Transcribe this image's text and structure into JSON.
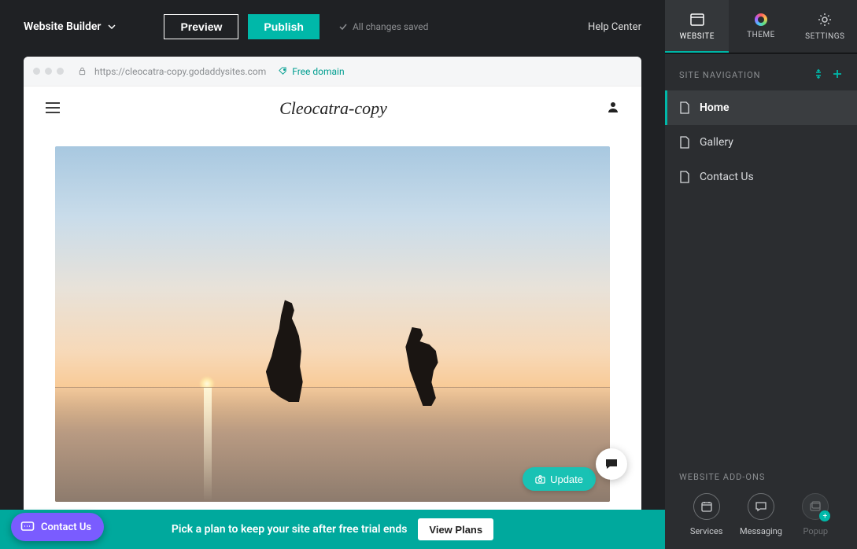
{
  "topbar": {
    "brand": "Website Builder",
    "preview_label": "Preview",
    "publish_label": "Publish",
    "saved_label": "All changes saved",
    "help_label": "Help Center"
  },
  "browser": {
    "url": "https://cleocatra-copy.godaddysites.com",
    "free_domain_label": "Free domain"
  },
  "page": {
    "logo_text": "Cleocatra-copy",
    "update_label": "Update"
  },
  "trial": {
    "message": "Pick a plan to keep your site after free trial ends",
    "cta": "View Plans"
  },
  "contact_pill": "Contact Us",
  "sidebar": {
    "tabs": {
      "website": "WEBSITE",
      "theme": "THEME",
      "settings": "SETTINGS"
    },
    "nav_header": "SITE NAVIGATION",
    "nav_items": [
      {
        "label": "Home"
      },
      {
        "label": "Gallery"
      },
      {
        "label": "Contact Us"
      }
    ],
    "addons_header": "WEBSITE ADD-ONS",
    "addons": [
      {
        "label": "Services"
      },
      {
        "label": "Messaging"
      },
      {
        "label": "Popup"
      }
    ]
  }
}
